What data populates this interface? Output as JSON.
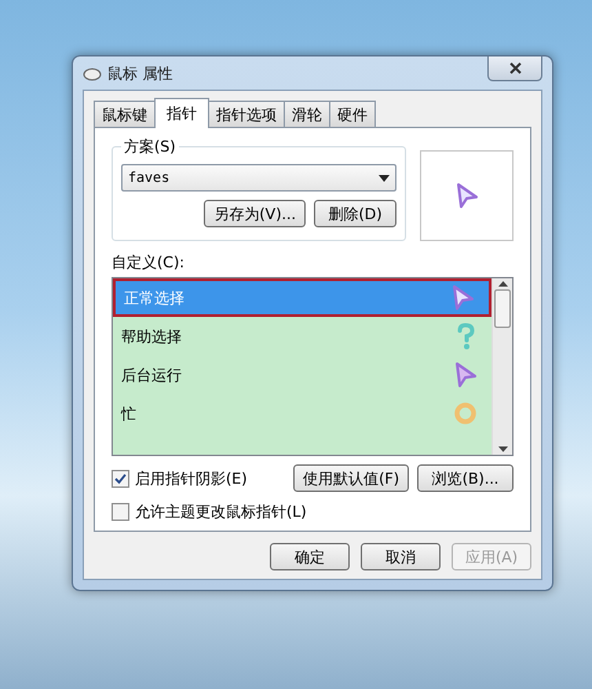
{
  "window": {
    "title": "鼠标 属性"
  },
  "tabs": [
    {
      "label": "鼠标键",
      "selected": false
    },
    {
      "label": "指针",
      "selected": true
    },
    {
      "label": "指针选项",
      "selected": false
    },
    {
      "label": "滑轮",
      "selected": false
    },
    {
      "label": "硬件",
      "selected": false
    }
  ],
  "scheme": {
    "label": "方案(S)",
    "value": "faves",
    "buttons": [
      "另存为(V)...",
      "删除(D)"
    ]
  },
  "customize": {
    "label": "自定义(C):",
    "items": [
      {
        "label": "正常选择",
        "kind": "arrow",
        "selected": true
      },
      {
        "label": "帮助选择",
        "kind": "help",
        "selected": false
      },
      {
        "label": "后台运行",
        "kind": "working",
        "selected": false
      },
      {
        "label": "忙",
        "kind": "busy",
        "selected": false
      }
    ]
  },
  "options": [
    {
      "label": "启用指针阴影(E)",
      "checked": true
    },
    {
      "label": "允许主题更改鼠标指针(L)",
      "checked": false
    }
  ],
  "list_buttons": [
    "使用默认值(F)",
    "浏览(B)..."
  ],
  "footer_buttons": [
    {
      "label": "确定",
      "disabled": false
    },
    {
      "label": "取消",
      "disabled": false
    },
    {
      "label": "应用(A)",
      "disabled": true
    }
  ]
}
